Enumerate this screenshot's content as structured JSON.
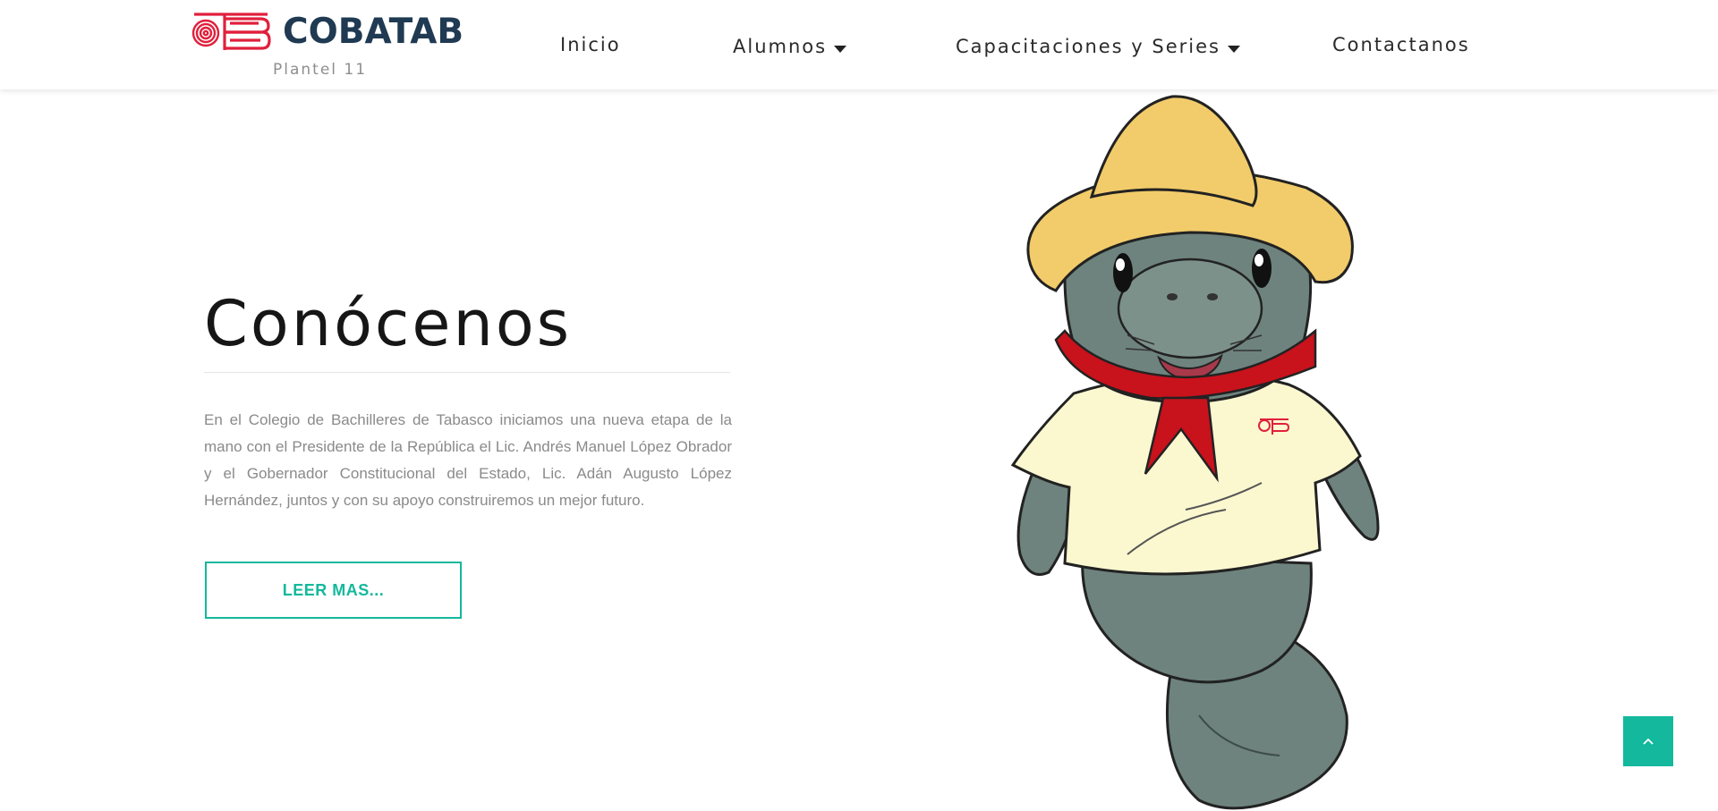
{
  "brand": {
    "name": "COBATAB",
    "subtitle": "Plantel 11",
    "mark_color": "#e0203c",
    "text_color": "#1f3a52"
  },
  "nav": {
    "items": [
      {
        "label": "Inicio",
        "has_dropdown": false
      },
      {
        "label": "Alumnos",
        "has_dropdown": true
      },
      {
        "label": "Capacitaciones y Series",
        "has_dropdown": true
      },
      {
        "label": "Contactanos",
        "has_dropdown": false
      }
    ]
  },
  "hero": {
    "title": "Conócenos",
    "body": "En el Colegio de Bachilleres de Tabasco iniciamos una nueva etapa de la mano con el Presidente de la República el Lic. Andrés Manuel López Obrador y el Gobernador Constitucional del Estado, Lic. Adán Augusto López Hernández, juntos y con su apoyo construiremos un mejor futuro.",
    "button_label": "LEER MAS...",
    "accent_color": "#14b89c"
  },
  "mascot": {
    "icon": "manatee-mascot-illustration"
  },
  "back_to_top": {
    "icon": "chevron-up-icon"
  }
}
